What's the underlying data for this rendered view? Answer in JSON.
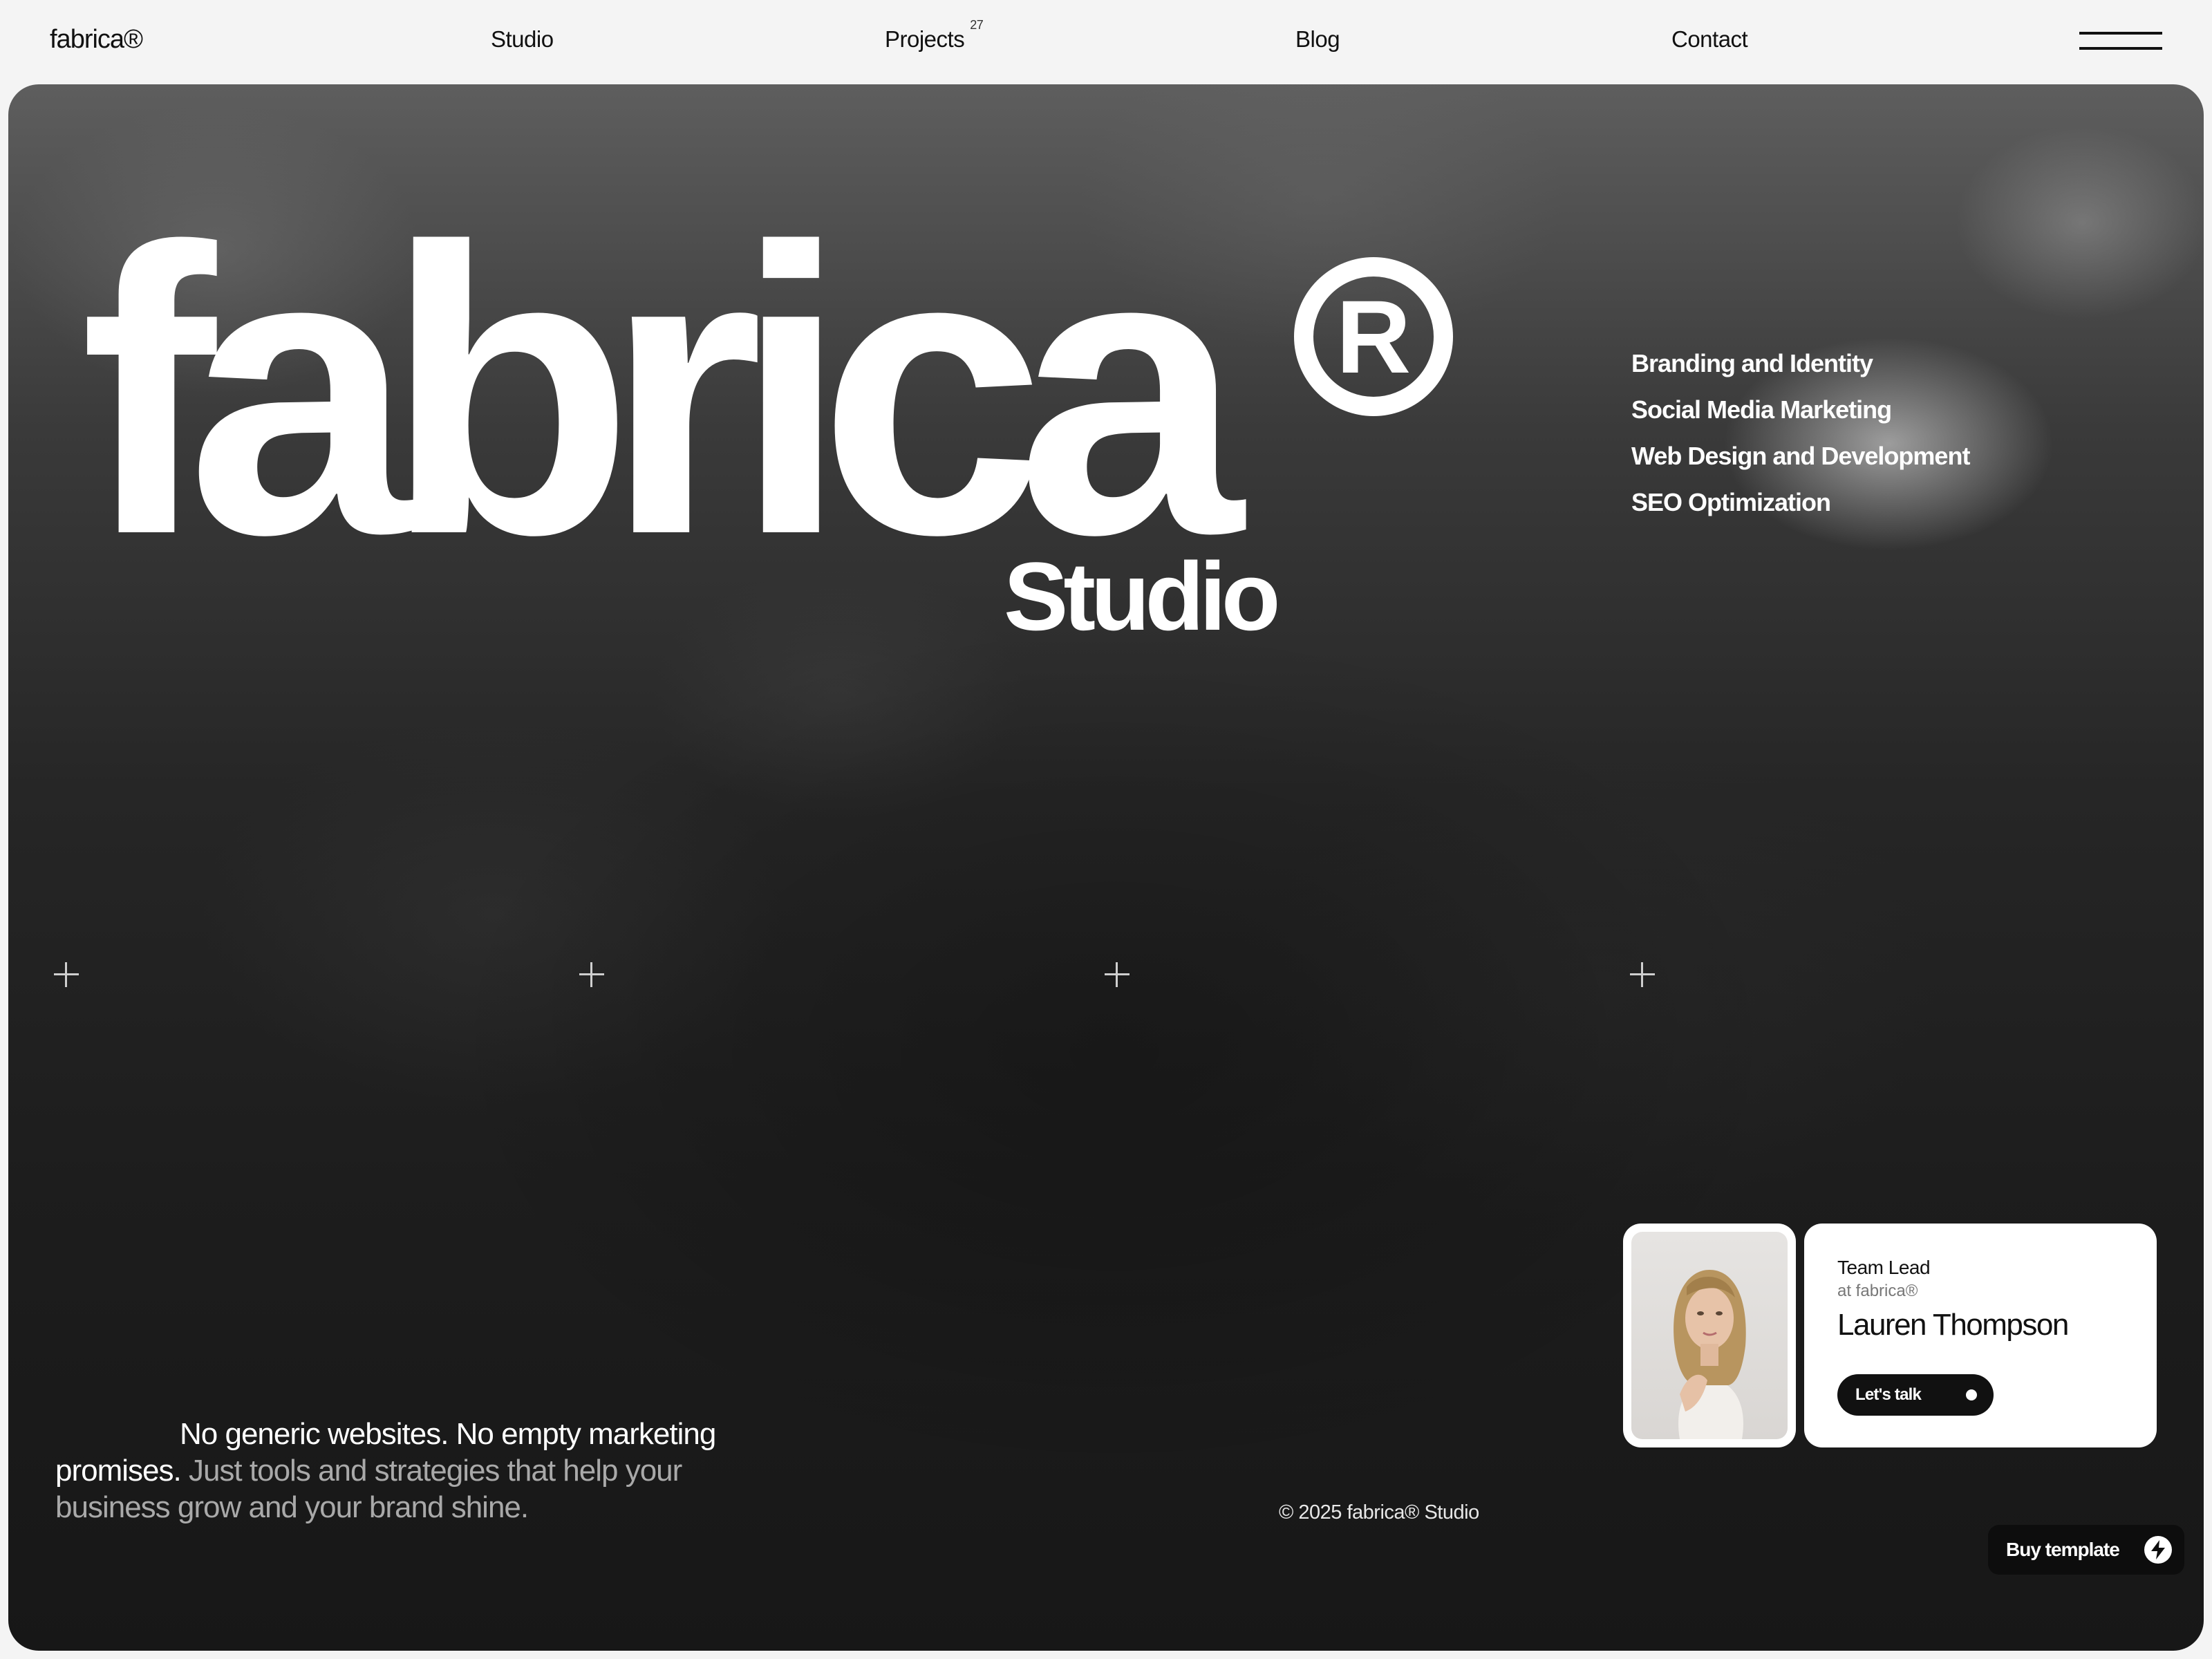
{
  "nav": {
    "logo": "fabrica®",
    "links": [
      {
        "label": "Studio"
      },
      {
        "label": "Projects",
        "badge": "27"
      },
      {
        "label": "Blog"
      },
      {
        "label": "Contact"
      }
    ],
    "menu_icon": "hamburger-icon"
  },
  "hero": {
    "title": "fabrica",
    "title_mark": "R",
    "subtitle": "Studio",
    "services": [
      "Branding and Identity",
      "Social Media Marketing",
      "Web Design and Development",
      "SEO Optimization"
    ],
    "tagline_lead": "No generic websites. No empty marketing promises.",
    "tagline_rest": "Just tools and strategies that help your business grow and your brand shine.",
    "copyright": "© 2025 fabrica® Studio"
  },
  "team_card": {
    "role": "Team Lead",
    "company": "at fabrica®",
    "name": "Lauren Thompson",
    "cta": "Let's talk"
  },
  "buy_button": {
    "label": "Buy template",
    "icon": "lightning-icon"
  },
  "colors": {
    "page_bg": "#f4f4f4",
    "hero_dark": "#1d1d1d",
    "text_light": "#ffffff",
    "text_muted": "#a9a9a9",
    "button_dark": "#111111"
  }
}
